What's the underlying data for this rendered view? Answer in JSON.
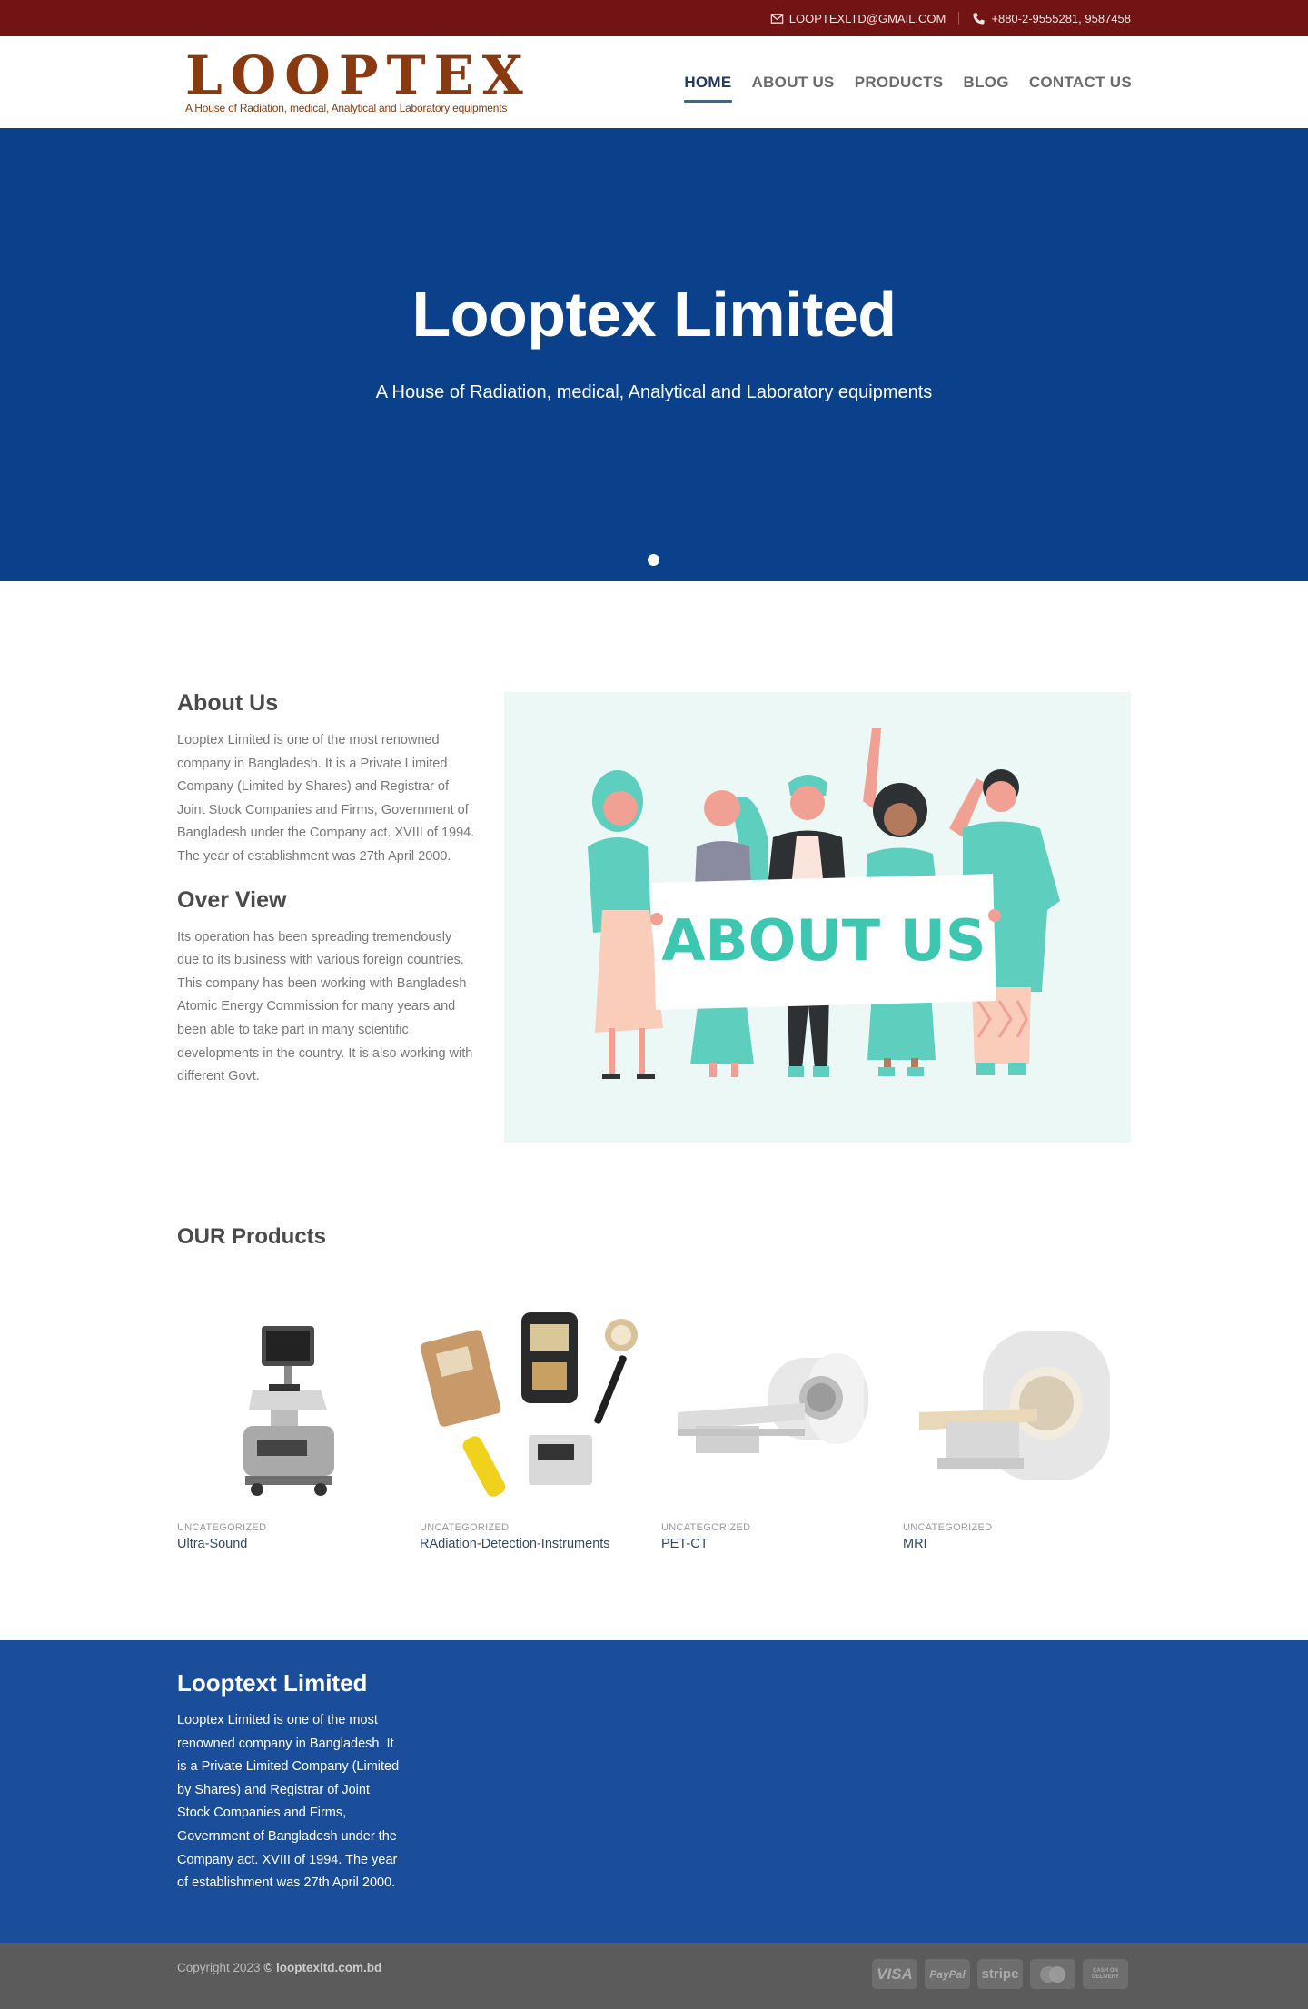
{
  "topbar": {
    "email": "LOOPTEXLTD@GMAIL.COM",
    "phone": "+880-2-9555281, 9587458"
  },
  "header": {
    "logo_text": "LOOPTEX",
    "logo_tagline": "A House of Radiation, medical, Analytical and Laboratory equipments",
    "nav": [
      "HOME",
      "ABOUT US",
      "PRODUCTS",
      "BLOG",
      "CONTACT US"
    ],
    "active_nav": "HOME"
  },
  "hero": {
    "title": "Looptex Limited",
    "subtitle": "A House of Radiation, medical, Analytical and Laboratory equipments"
  },
  "about": {
    "heading": "About Us",
    "text": "Looptex Limited is one of the most renowned company in Bangladesh. It is a Private Limited Company (Limited by Shares) and Registrar of Joint Stock Companies and Firms, Government of Bangladesh under the Company act. XVIII of 1994. The year of establishment was 27th April 2000.",
    "overview_heading": "Over View",
    "overview_text": "Its operation has been spreading tremendously due to its business with various foreign countries. This company has been working with Bangladesh Atomic Energy Commission for many years and been able to take part in many scientific developments in the country. It is also working with different Govt.",
    "banner_text": "ABOUT US"
  },
  "products": {
    "heading": "OUR Products",
    "items": [
      {
        "category": "UNCATEGORIZED",
        "name": "Ultra-Sound"
      },
      {
        "category": "UNCATEGORIZED",
        "name": "RAdiation-Detection-Instruments"
      },
      {
        "category": "UNCATEGORIZED",
        "name": "PET-CT"
      },
      {
        "category": "UNCATEGORIZED",
        "name": "MRI"
      }
    ]
  },
  "footer": {
    "title": "Looptext Limited",
    "text": "Looptex Limited is one of the most renowned company in Bangladesh. It is a Private Limited Company (Limited by Shares) and Registrar of Joint Stock Companies and Firms, Government of Bangladesh under the Company act. XVIII of 1994. The year of establishment was 27th April 2000.",
    "copyright_prefix": "Copyright 2023",
    "copyright_site": "© looptexltd.com.bd",
    "payments": [
      "VISA",
      "PayPal",
      "stripe",
      "mastercard",
      "CASH ON DELIVERY"
    ]
  },
  "colors": {
    "topbar": "#721314",
    "hero": "#0b418a",
    "footer": "#1a4e9b",
    "absolute_footer": "#5b5b5b",
    "accent": "#446084",
    "logo": "#8a3a10",
    "illustration_teal": "#5ecfbe"
  },
  "icons": [
    "envelope-icon",
    "phone-icon",
    "slider-dot-icon"
  ]
}
